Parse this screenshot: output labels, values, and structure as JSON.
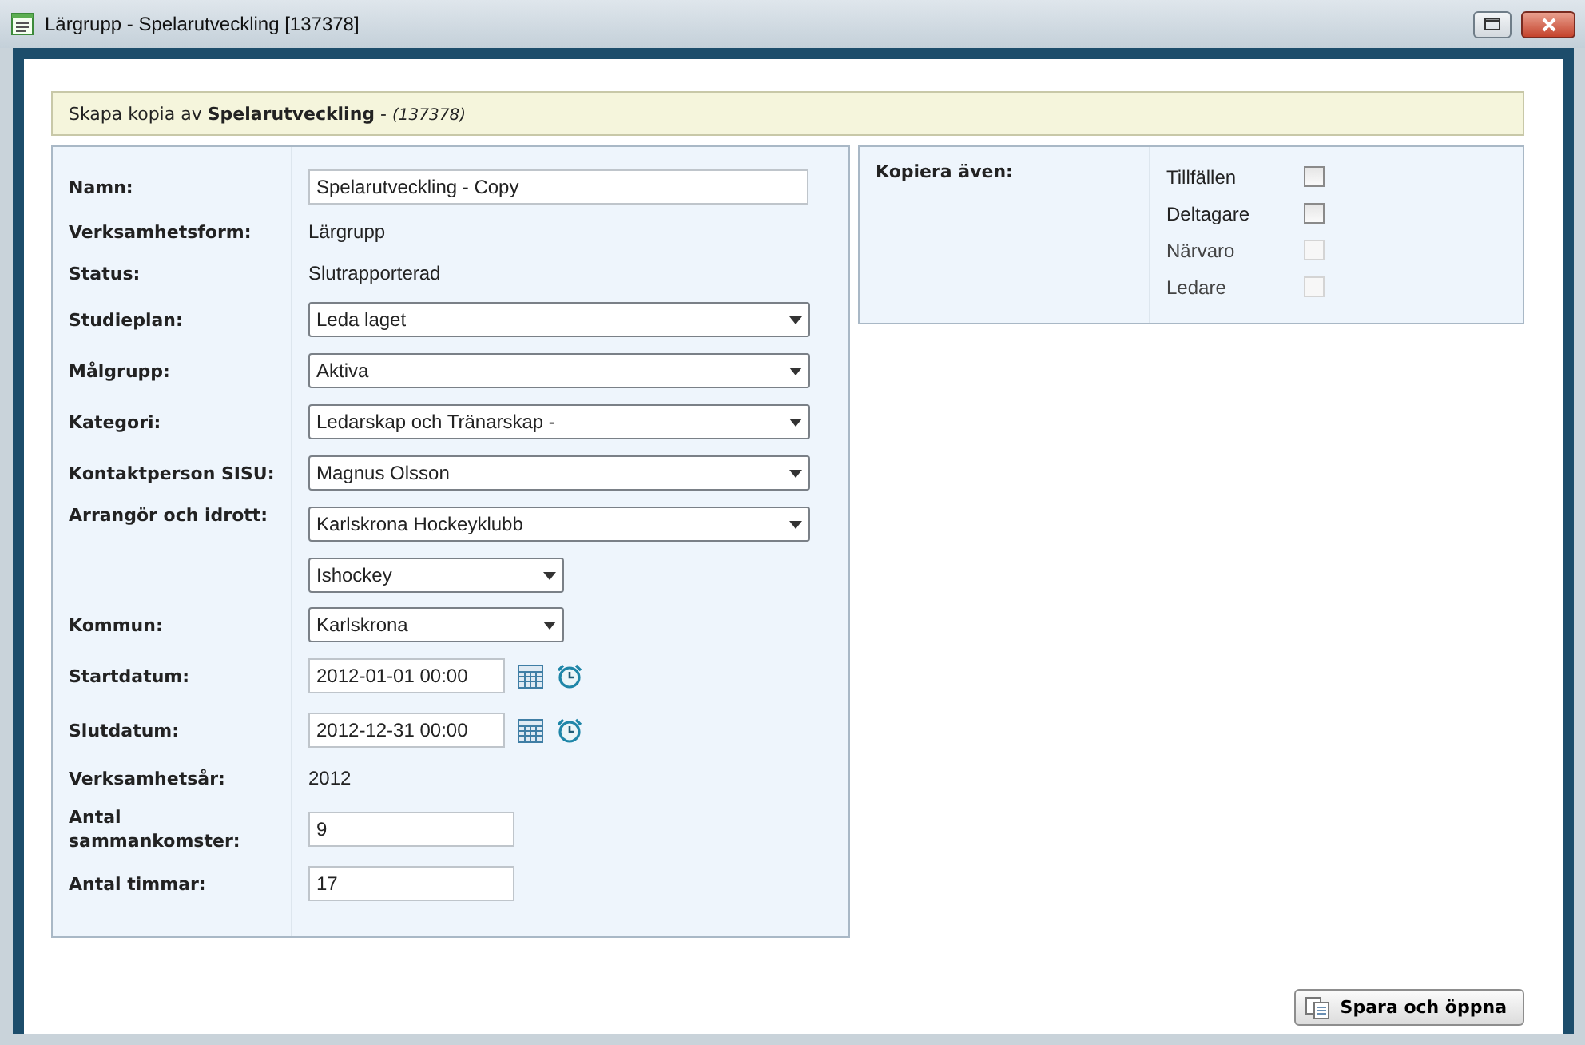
{
  "window": {
    "title": "Lärgrupp - Spelarutveckling [137378]"
  },
  "header": {
    "prefix": "Skapa kopia av ",
    "name": "Spelarutveckling",
    "separator": " - ",
    "id": "(137378)"
  },
  "fields": [
    {
      "label": "Namn:",
      "kind": "input",
      "value": "Spelarutveckling - Copy"
    },
    {
      "label": "Verksamhetsform:",
      "kind": "text",
      "value": "Lärgrupp"
    },
    {
      "label": "Status:",
      "kind": "text",
      "value": "Slutrapporterad"
    },
    {
      "label": "Studieplan:",
      "kind": "select",
      "value": "Leda laget"
    },
    {
      "label": "Målgrupp:",
      "kind": "select",
      "value": "Aktiva"
    },
    {
      "label": "Kategori:",
      "kind": "select",
      "value": "Ledarskap och Tränarskap -"
    },
    {
      "label": "Kontaktperson SISU:",
      "kind": "select",
      "value": "Magnus Olsson"
    },
    {
      "label": "Arrangör och idrott:",
      "kind": "select",
      "value": "Karlskrona Hockeyklubb",
      "extra": "Ishockey"
    },
    {
      "label": "Kommun:",
      "kind": "select-short",
      "value": "Karlskrona"
    },
    {
      "label": "Startdatum:",
      "kind": "date",
      "value": "2012-01-01 00:00"
    },
    {
      "label": "Slutdatum:",
      "kind": "date",
      "value": "2012-12-31 00:00"
    },
    {
      "label": "Verksamhetsår:",
      "kind": "text",
      "value": "2012"
    },
    {
      "label": "Antal sammankomster:",
      "kind": "input-short",
      "value": "9"
    },
    {
      "label": "Antal timmar:",
      "kind": "input-short",
      "value": "17"
    }
  ],
  "copy_also": {
    "label": "Kopiera även:",
    "options": [
      {
        "label": "Tillfällen",
        "checked": false,
        "disabled": false
      },
      {
        "label": "Deltagare",
        "checked": false,
        "disabled": false
      },
      {
        "label": "Närvaro",
        "checked": false,
        "disabled": true
      },
      {
        "label": "Ledare",
        "checked": false,
        "disabled": true
      }
    ]
  },
  "save_button": "Spara och öppna"
}
